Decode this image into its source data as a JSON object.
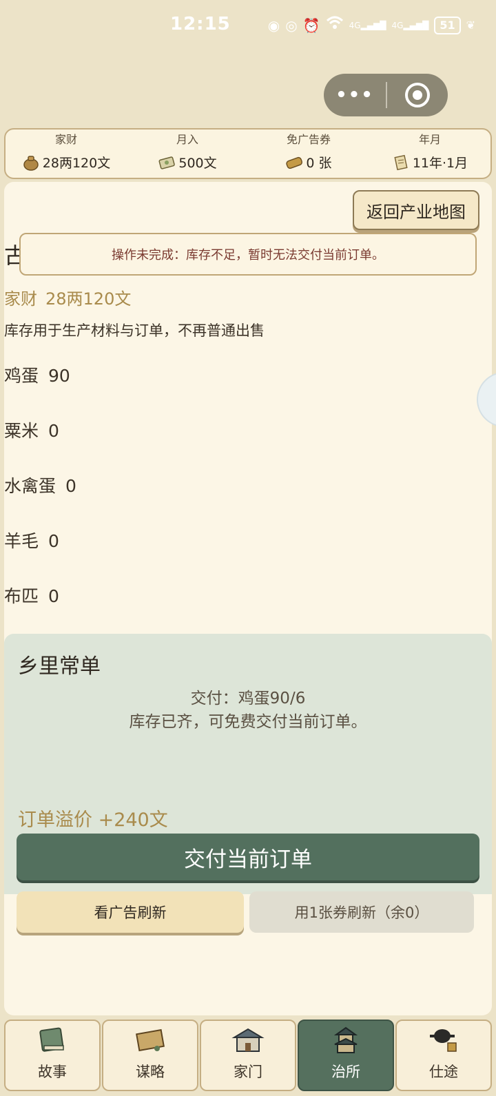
{
  "status_bar": {
    "time": "12:15",
    "network1": "4G",
    "network2": "4G",
    "battery": "51"
  },
  "stats": {
    "wealth_label": "家财",
    "wealth_value": "28两120文",
    "income_label": "月入",
    "income_value": "500文",
    "coupon_label": "免广告券",
    "coupon_value": "0 张",
    "date_label": "年月",
    "date_value": "11年·1月"
  },
  "panel": {
    "back_button": "返回产业地图",
    "title": "古镇集",
    "toast": "操作未完成：库存不足，暂时无法交付当前订单。",
    "wealth_label": "家财",
    "wealth_value": "28两120文",
    "note": "库存用于生产材料与订单，不再普通出售",
    "inventory": [
      {
        "name": "鸡蛋",
        "qty": "90"
      },
      {
        "name": "粟米",
        "qty": "0"
      },
      {
        "name": "水禽蛋",
        "qty": "0"
      },
      {
        "name": "羊毛",
        "qty": "0"
      },
      {
        "name": "布匹",
        "qty": "0"
      }
    ]
  },
  "order": {
    "title": "乡里常单",
    "deliver_text": "交付：鸡蛋90/6",
    "status_text": "库存已齐，可免费交付当前订单。",
    "premium": "订单溢价 +240文",
    "deliver_button": "交付当前订单",
    "ad_refresh_button": "看广告刷新",
    "coupon_refresh_button": "用1张券刷新（余0）"
  },
  "tabs": [
    {
      "label": "故事",
      "icon": "book-icon",
      "active": false
    },
    {
      "label": "谋略",
      "icon": "scroll-map-icon",
      "active": false
    },
    {
      "label": "家门",
      "icon": "house-icon",
      "active": false
    },
    {
      "label": "治所",
      "icon": "tower-icon",
      "active": true
    },
    {
      "label": "仕途",
      "icon": "official-hat-icon",
      "active": false
    }
  ],
  "colors": {
    "background": "#ece3c8",
    "panel": "#fcf6e6",
    "accent_gold": "#a98b4c",
    "active_tab": "#55705e",
    "order_card": "#dde5d8",
    "toast_text": "#7a3a30"
  }
}
